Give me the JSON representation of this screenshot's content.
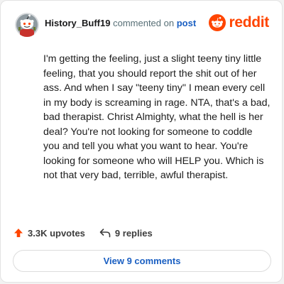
{
  "header": {
    "username": "History_Buff19",
    "commented_text": "commented on",
    "post_link": "post",
    "brand": "reddit"
  },
  "comment": {
    "text": "I'm getting the feeling, just a slight teeny tiny little feeling, that you should report the shit out of her ass. And when I say \"teeny tiny\" I mean every cell in my body is screaming in rage. NTA, that's a bad, bad therapist. Christ Almighty, what the hell is her deal? You're not looking for someone to coddle you and tell you what you want to hear. You're looking for someone who will HELP you. Which is not that very bad, terrible, awful therapist."
  },
  "actions": {
    "upvotes": "3.3K upvotes",
    "replies": "9 replies"
  },
  "footer": {
    "view_comments": "View 9 comments"
  },
  "icons": {
    "avatar": "snoo-avatar-icon",
    "brand": "reddit-logo-icon",
    "upvote": "upvote-arrow-icon",
    "reply": "reply-arrow-icon"
  },
  "colors": {
    "brand": "#ff4500",
    "link": "#1a5fc2",
    "upvote": "#ff4500"
  }
}
